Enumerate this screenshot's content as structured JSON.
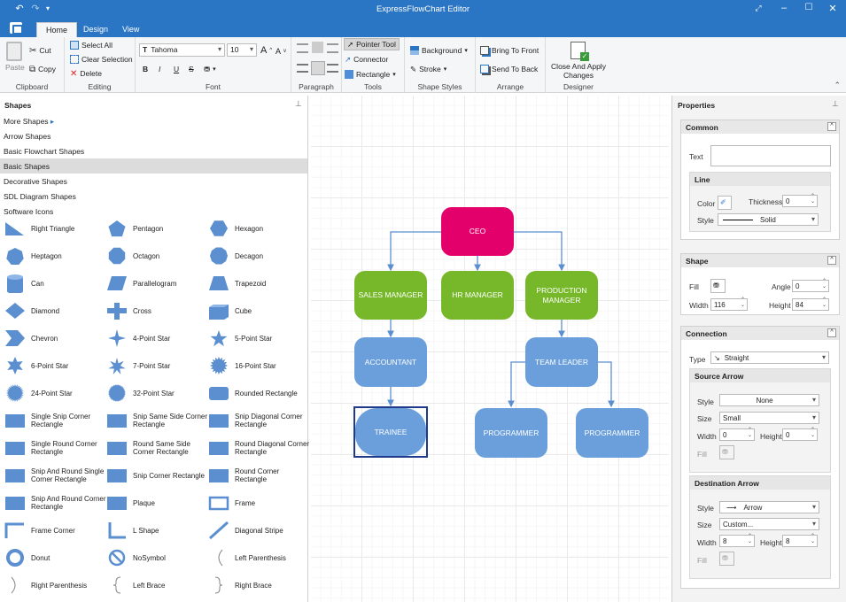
{
  "window": {
    "title": "ExpressFlowChart Editor"
  },
  "ribbon": {
    "tabs": [
      "Home",
      "Design",
      "View"
    ],
    "clipboard": {
      "name": "Clipboard",
      "paste": "Paste",
      "cut": "Cut",
      "copy": "Copy"
    },
    "editing": {
      "name": "Editing",
      "select_all": "Select All",
      "clear_selection": "Clear Selection",
      "delete": "Delete"
    },
    "font": {
      "name": "Font",
      "family": "Tahoma",
      "size": "10"
    },
    "paragraph": {
      "name": "Paragraph"
    },
    "tools": {
      "name": "Tools",
      "pointer": "Pointer Tool",
      "connector": "Connector",
      "rectangle": "Rectangle"
    },
    "shape_styles": {
      "name": "Shape Styles",
      "background": "Background",
      "stroke": "Stroke"
    },
    "arrange": {
      "name": "Arrange",
      "front": "Bring To Front",
      "back": "Send To Back"
    },
    "designer": {
      "name": "Designer",
      "close": "Close And Apply Changes"
    }
  },
  "shapes_panel": {
    "title": "Shapes",
    "categories": [
      "More Shapes",
      "Arrow Shapes",
      "Basic Flowchart Shapes",
      "Basic Shapes",
      "Decorative Shapes",
      "SDL Diagram Shapes",
      "Software Icons"
    ],
    "selected_category": "Basic Shapes",
    "items": [
      "Right Triangle",
      "Pentagon",
      "Hexagon",
      "Heptagon",
      "Octagon",
      "Decagon",
      "Can",
      "Parallelogram",
      "Trapezoid",
      "Diamond",
      "Cross",
      "Cube",
      "Chevron",
      "4-Point Star",
      "5-Point Star",
      "6-Point Star",
      "7-Point Star",
      "16-Point Star",
      "24-Point Star",
      "32-Point Star",
      "Rounded Rectangle",
      "Single Snip Corner Rectangle",
      "Snip Same Side Corner Rectangle",
      "Snip Diagonal Corner Rectangle",
      "Single Round Corner Rectangle",
      "Round Same Side Corner Rectangle",
      "Round Diagonal Corner Rectangle",
      "Snip And Round Single Corner Rectangle",
      "Snip Corner Rectangle",
      "Round Corner Rectangle",
      "Snip And Round Corner Rectangle",
      "Plaque",
      "Frame",
      "Frame Corner",
      "L Shape",
      "Diagonal Stripe",
      "Donut",
      "NoSymbol",
      "Left Parenthesis",
      "Right Parenthesis",
      "Left Brace",
      "Right Brace"
    ]
  },
  "diagram": {
    "nodes": {
      "ceo": "CEO",
      "sales": "SALES MANAGER",
      "hr": "HR MANAGER",
      "production": "PRODUCTION MANAGER",
      "accountant": "ACCOUNTANT",
      "team_leader": "TEAM LEADER",
      "trainee": "TRAINEE",
      "programmer1": "PROGRAMMER",
      "programmer2": "PROGRAMMER"
    },
    "colors": {
      "ceo": "#e4006b",
      "manager": "#77b82a",
      "staff": "#6b9fdc",
      "connector": "#5b8fd0"
    }
  },
  "properties": {
    "title": "Properties",
    "common": {
      "title": "Common",
      "text_label": "Text",
      "text_value": "",
      "line": {
        "title": "Line",
        "color_label": "Color",
        "thickness_label": "Thickness",
        "thickness": "0",
        "style_label": "Style",
        "style": "Solid"
      }
    },
    "shape": {
      "title": "Shape",
      "fill_label": "Fill",
      "angle_label": "Angle",
      "angle": "0",
      "width_label": "Width",
      "width": "116",
      "height_label": "Height",
      "height": "84"
    },
    "connection": {
      "title": "Connection",
      "type_label": "Type",
      "type": "Straight",
      "source_arrow": {
        "title": "Source Arrow",
        "style_label": "Style",
        "style": "None",
        "size_label": "Size",
        "size": "Small",
        "width_label": "Width",
        "width": "0",
        "height_label": "Height",
        "height": "0",
        "fill_label": "Fill"
      },
      "destination_arrow": {
        "title": "Destination Arrow",
        "style_label": "Style",
        "style": "Arrow",
        "size_label": "Size",
        "size": "Custom...",
        "width_label": "Width",
        "width": "8",
        "height_label": "Height",
        "height": "8",
        "fill_label": "Fill"
      }
    }
  }
}
